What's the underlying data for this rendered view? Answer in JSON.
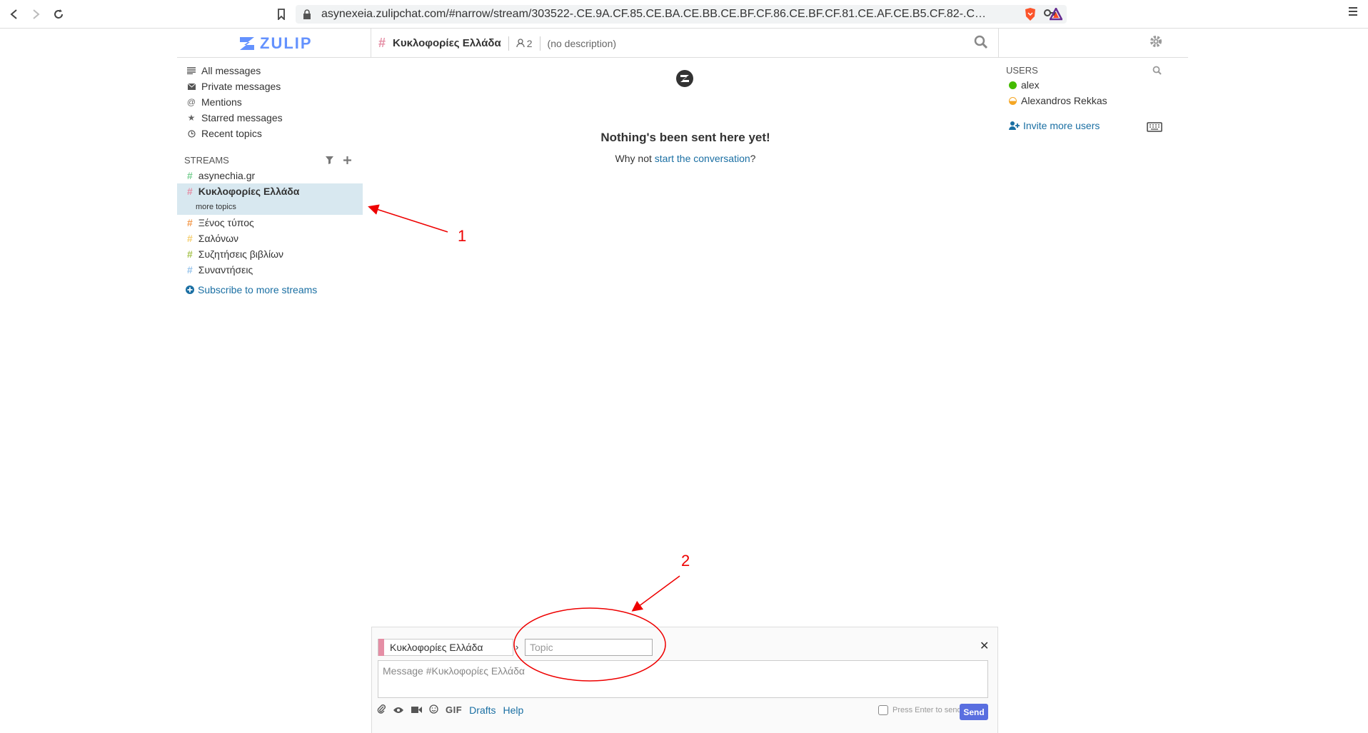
{
  "browser": {
    "url": "asynexeia.zulipchat.com/#narrow/stream/303522-.CE.9A.CF.85.CE.BA.CE.BB.CE.BF.CF.86.CE.BF.CF.81.CE.AF.CE.B5.CF.82-.CE.95.C..."
  },
  "header": {
    "logo_text": "ZULIP",
    "stream_name": "Κυκλοφορίες Ελλάδα",
    "subscriber_count": "2",
    "description": "(no description)"
  },
  "sidebar": {
    "nav": [
      {
        "label": "All messages",
        "icon": "all-messages-icon"
      },
      {
        "label": "Private messages",
        "icon": "envelope-icon"
      },
      {
        "label": "Mentions",
        "icon": "at-icon"
      },
      {
        "label": "Starred messages",
        "icon": "star-icon"
      },
      {
        "label": "Recent topics",
        "icon": "clock-icon"
      }
    ],
    "streams_header": "STREAMS",
    "streams": [
      {
        "name": "asynechia.gr",
        "color": "#76ce90"
      },
      {
        "name": "Κυκλοφορίες Ελλάδα",
        "color": "#e58ea5"
      },
      {
        "name": "Ξένος τύπος",
        "color": "#f39a4d"
      },
      {
        "name": "Σαλόνων",
        "color": "#f5ce6e"
      },
      {
        "name": "Συζητήσεις βιβλίων",
        "color": "#a6c34d"
      },
      {
        "name": "Συναντήσεις",
        "color": "#94c2eb"
      }
    ],
    "more_topics": "more topics",
    "subscribe_more": "Subscribe to more streams"
  },
  "main": {
    "empty_title": "Nothing's been sent here yet!",
    "empty_prefix": "Why not ",
    "empty_link": "start the conversation",
    "empty_suffix": "?"
  },
  "users": {
    "header": "USERS",
    "list": [
      {
        "name": "alex",
        "status_color": "#44bb00"
      },
      {
        "name": "Alexandros Rekkas",
        "status_color": "#f5a623"
      }
    ],
    "invite": "Invite more users"
  },
  "compose": {
    "stream_name": "Κυκλοφορίες Ελλάδα",
    "topic_placeholder": "Topic",
    "message_placeholder": "Message #Κυκλοφορίες Ελλάδα",
    "drafts": "Drafts",
    "help": "Help",
    "gif": "GIF",
    "enter_to_send": "Press Enter to send",
    "send": "Send"
  },
  "annotations": {
    "label_1": "1",
    "label_2": "2",
    "color": "#e00000"
  }
}
